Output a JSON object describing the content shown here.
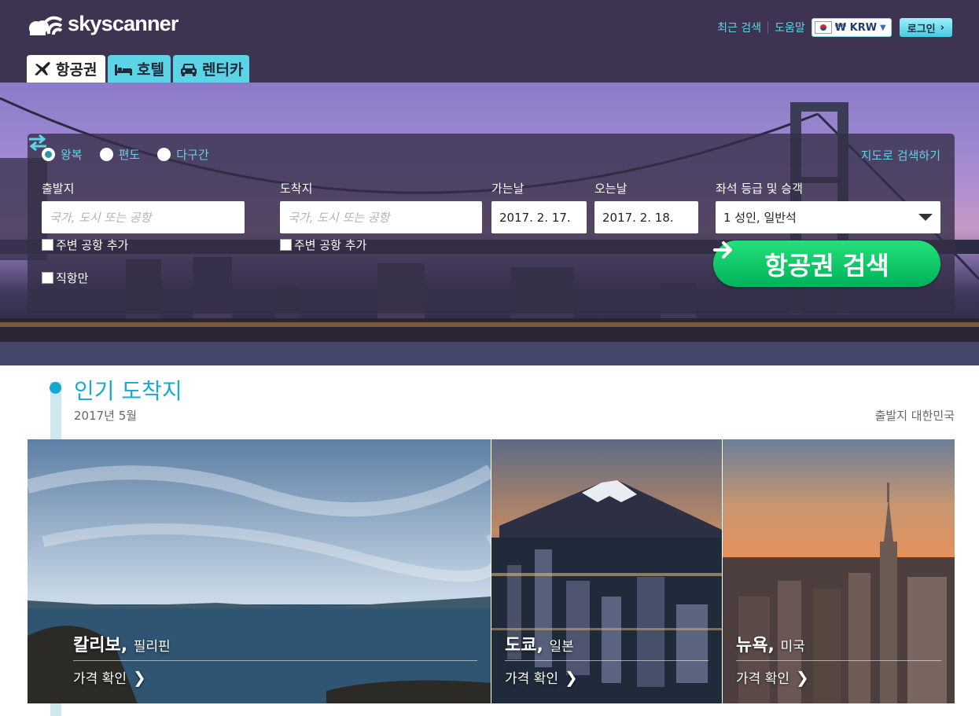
{
  "brand": {
    "name": "skyscanner"
  },
  "top_nav": {
    "recent_search": "최근 검색",
    "help": "도움말",
    "currency": "₩ KRW",
    "login": "로그인"
  },
  "tabs": [
    {
      "label": "항공권",
      "icon": "airplane-icon",
      "active": true
    },
    {
      "label": "호텔",
      "icon": "bed-icon",
      "active": false
    },
    {
      "label": "렌터카",
      "icon": "car-icon",
      "active": false
    }
  ],
  "search": {
    "trip_types": [
      {
        "label": "왕복",
        "selected": true
      },
      {
        "label": "편도",
        "selected": false
      },
      {
        "label": "다구간",
        "selected": false
      }
    ],
    "map_search": "지도로 검색하기",
    "origin_label": "출발지",
    "origin_placeholder": "국가, 도시 또는 공항",
    "destination_label": "도착지",
    "destination_placeholder": "국가, 도시 또는 공항",
    "depart_label": "가는날",
    "depart_value": "2017. 2. 17.",
    "return_label": "오는날",
    "return_value": "2017. 2. 18.",
    "cabin_label": "좌석 등급 및 승객",
    "cabin_value": "1 성인, 일반석",
    "nearby_origin": "주변 공항 추가",
    "nearby_destination": "주변 공항 추가",
    "direct_only": "직항만",
    "search_button": "항공권 검색"
  },
  "popular": {
    "title": "인기 도착지",
    "date": "2017년 5월",
    "origin": "출발지 대한민국",
    "cards": [
      {
        "city": "칼리보",
        "country": "필리핀",
        "cta": "가격 확인"
      },
      {
        "city": "도쿄",
        "country": "일본",
        "cta": "가격 확인"
      },
      {
        "city": "뉴욕",
        "country": "미국",
        "cta": "가격 확인"
      }
    ]
  },
  "colors": {
    "header_bg": "#3e3452",
    "accent_cyan": "#5dd3e6",
    "search_green": "#00b25b",
    "title_blue": "#19a8d2"
  }
}
